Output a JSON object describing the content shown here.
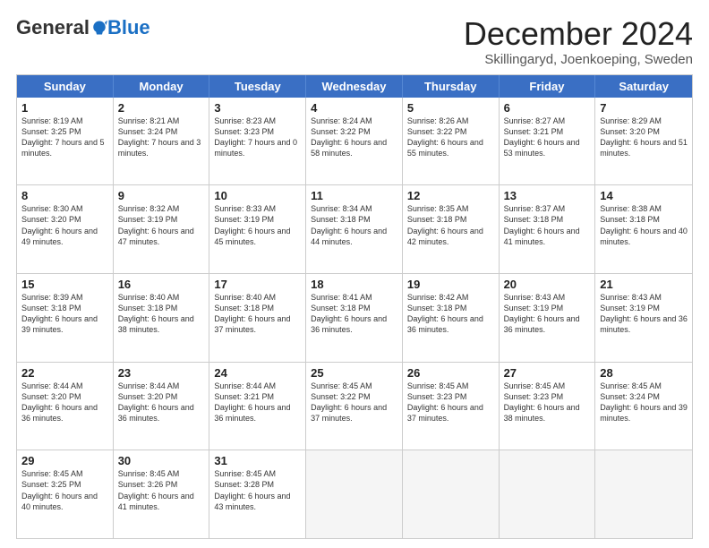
{
  "logo": {
    "general": "General",
    "blue": "Blue"
  },
  "header": {
    "month": "December 2024",
    "location": "Skillingaryd, Joenkoeping, Sweden"
  },
  "days": [
    "Sunday",
    "Monday",
    "Tuesday",
    "Wednesday",
    "Thursday",
    "Friday",
    "Saturday"
  ],
  "weeks": [
    [
      {
        "day": 1,
        "sunrise": "8:19 AM",
        "sunset": "3:25 PM",
        "daylight": "7 hours and 5 minutes."
      },
      {
        "day": 2,
        "sunrise": "8:21 AM",
        "sunset": "3:24 PM",
        "daylight": "7 hours and 3 minutes."
      },
      {
        "day": 3,
        "sunrise": "8:23 AM",
        "sunset": "3:23 PM",
        "daylight": "7 hours and 0 minutes."
      },
      {
        "day": 4,
        "sunrise": "8:24 AM",
        "sunset": "3:22 PM",
        "daylight": "6 hours and 58 minutes."
      },
      {
        "day": 5,
        "sunrise": "8:26 AM",
        "sunset": "3:22 PM",
        "daylight": "6 hours and 55 minutes."
      },
      {
        "day": 6,
        "sunrise": "8:27 AM",
        "sunset": "3:21 PM",
        "daylight": "6 hours and 53 minutes."
      },
      {
        "day": 7,
        "sunrise": "8:29 AM",
        "sunset": "3:20 PM",
        "daylight": "6 hours and 51 minutes."
      }
    ],
    [
      {
        "day": 8,
        "sunrise": "8:30 AM",
        "sunset": "3:20 PM",
        "daylight": "6 hours and 49 minutes."
      },
      {
        "day": 9,
        "sunrise": "8:32 AM",
        "sunset": "3:19 PM",
        "daylight": "6 hours and 47 minutes."
      },
      {
        "day": 10,
        "sunrise": "8:33 AM",
        "sunset": "3:19 PM",
        "daylight": "6 hours and 45 minutes."
      },
      {
        "day": 11,
        "sunrise": "8:34 AM",
        "sunset": "3:18 PM",
        "daylight": "6 hours and 44 minutes."
      },
      {
        "day": 12,
        "sunrise": "8:35 AM",
        "sunset": "3:18 PM",
        "daylight": "6 hours and 42 minutes."
      },
      {
        "day": 13,
        "sunrise": "8:37 AM",
        "sunset": "3:18 PM",
        "daylight": "6 hours and 41 minutes."
      },
      {
        "day": 14,
        "sunrise": "8:38 AM",
        "sunset": "3:18 PM",
        "daylight": "6 hours and 40 minutes."
      }
    ],
    [
      {
        "day": 15,
        "sunrise": "8:39 AM",
        "sunset": "3:18 PM",
        "daylight": "6 hours and 39 minutes."
      },
      {
        "day": 16,
        "sunrise": "8:40 AM",
        "sunset": "3:18 PM",
        "daylight": "6 hours and 38 minutes."
      },
      {
        "day": 17,
        "sunrise": "8:40 AM",
        "sunset": "3:18 PM",
        "daylight": "6 hours and 37 minutes."
      },
      {
        "day": 18,
        "sunrise": "8:41 AM",
        "sunset": "3:18 PM",
        "daylight": "6 hours and 36 minutes."
      },
      {
        "day": 19,
        "sunrise": "8:42 AM",
        "sunset": "3:18 PM",
        "daylight": "6 hours and 36 minutes."
      },
      {
        "day": 20,
        "sunrise": "8:43 AM",
        "sunset": "3:19 PM",
        "daylight": "6 hours and 36 minutes."
      },
      {
        "day": 21,
        "sunrise": "8:43 AM",
        "sunset": "3:19 PM",
        "daylight": "6 hours and 36 minutes."
      }
    ],
    [
      {
        "day": 22,
        "sunrise": "8:44 AM",
        "sunset": "3:20 PM",
        "daylight": "6 hours and 36 minutes."
      },
      {
        "day": 23,
        "sunrise": "8:44 AM",
        "sunset": "3:20 PM",
        "daylight": "6 hours and 36 minutes."
      },
      {
        "day": 24,
        "sunrise": "8:44 AM",
        "sunset": "3:21 PM",
        "daylight": "6 hours and 36 minutes."
      },
      {
        "day": 25,
        "sunrise": "8:45 AM",
        "sunset": "3:22 PM",
        "daylight": "6 hours and 37 minutes."
      },
      {
        "day": 26,
        "sunrise": "8:45 AM",
        "sunset": "3:23 PM",
        "daylight": "6 hours and 37 minutes."
      },
      {
        "day": 27,
        "sunrise": "8:45 AM",
        "sunset": "3:23 PM",
        "daylight": "6 hours and 38 minutes."
      },
      {
        "day": 28,
        "sunrise": "8:45 AM",
        "sunset": "3:24 PM",
        "daylight": "6 hours and 39 minutes."
      }
    ],
    [
      {
        "day": 29,
        "sunrise": "8:45 AM",
        "sunset": "3:25 PM",
        "daylight": "6 hours and 40 minutes."
      },
      {
        "day": 30,
        "sunrise": "8:45 AM",
        "sunset": "3:26 PM",
        "daylight": "6 hours and 41 minutes."
      },
      {
        "day": 31,
        "sunrise": "8:45 AM",
        "sunset": "3:28 PM",
        "daylight": "6 hours and 43 minutes."
      },
      null,
      null,
      null,
      null
    ]
  ]
}
